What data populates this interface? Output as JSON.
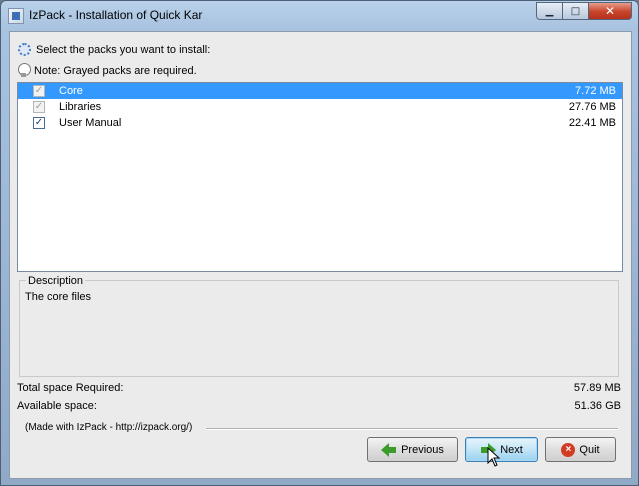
{
  "window": {
    "title": "IzPack - Installation of Quick Kar",
    "minimize_glyph": "▁",
    "maximize_glyph": "□",
    "close_glyph": "✕"
  },
  "hints": {
    "select": "Select the packs you want to install:",
    "note": "Note: Grayed packs are required."
  },
  "packs": [
    {
      "name": "Core",
      "size": "7.72 MB",
      "checked": true,
      "required": true,
      "selected": true
    },
    {
      "name": "Libraries",
      "size": "27.76 MB",
      "checked": true,
      "required": true,
      "selected": false
    },
    {
      "name": "User Manual",
      "size": "22.41 MB",
      "checked": true,
      "required": false,
      "selected": false
    }
  ],
  "description": {
    "legend": "Description",
    "text": "The core files"
  },
  "space": {
    "required_label": "Total space Required:",
    "required_value": "57.89 MB",
    "available_label": "Available space:",
    "available_value": "51.36 GB"
  },
  "made_with": "(Made with IzPack - http://izpack.org/)",
  "buttons": {
    "previous": "Previous",
    "next": "Next",
    "quit": "Quit"
  },
  "icons": [
    "app-icon",
    "gear-icon",
    "bulb-icon",
    "arrow-left-icon",
    "arrow-right-icon",
    "quit-icon",
    "cursor-icon"
  ],
  "colors": {
    "selection": "#3399ff",
    "accent": "#3b9c2b",
    "quit": "#d23b24"
  }
}
